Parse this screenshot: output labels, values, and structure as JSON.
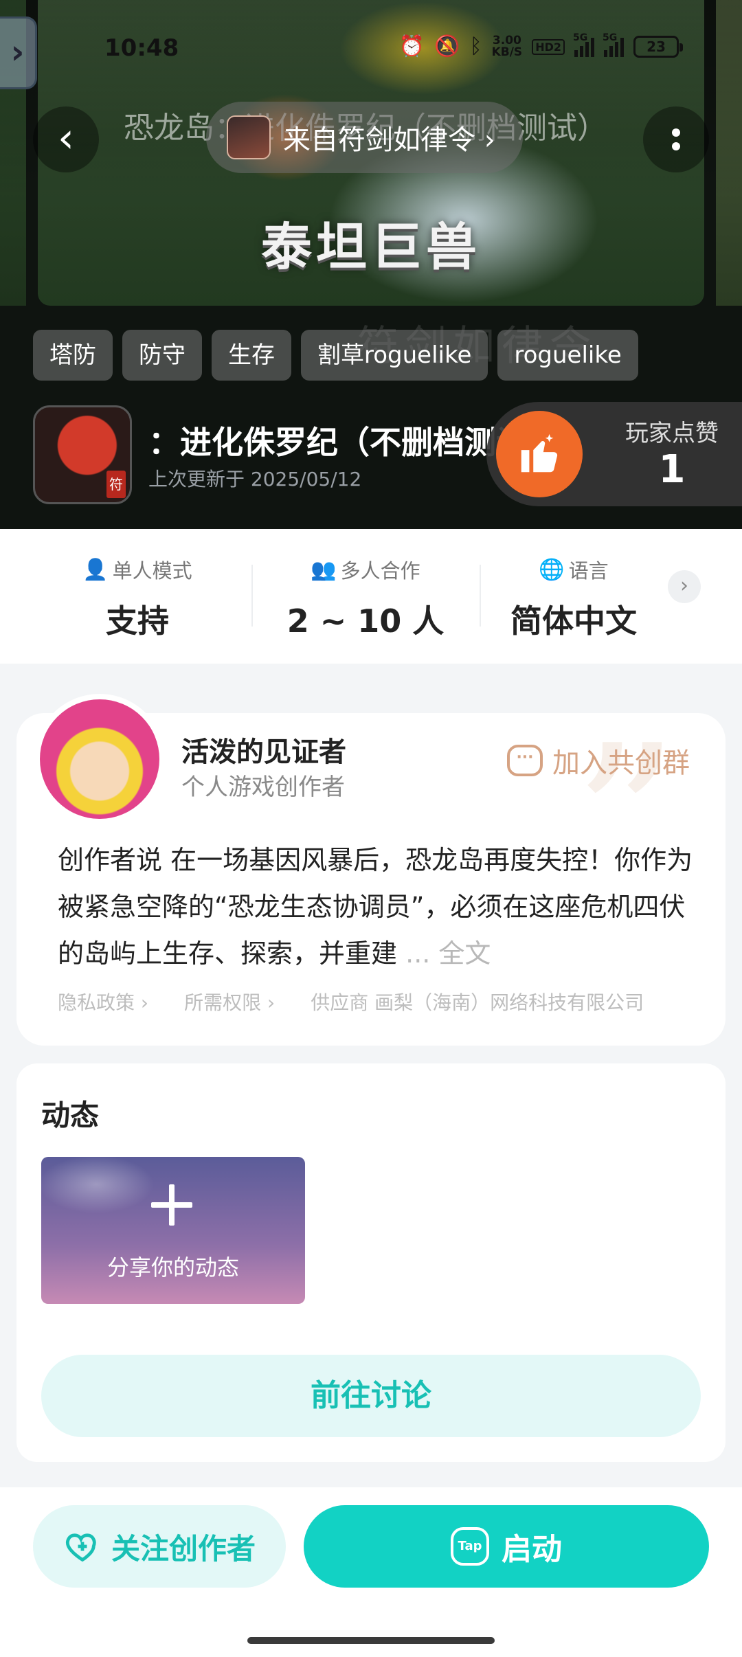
{
  "status_bar": {
    "time": "10:48",
    "net_speed_value": "3.00",
    "net_speed_unit": "KB/S",
    "hd_label": "HD2",
    "sig1_label": "5G",
    "sig2_label": "5G",
    "battery": "23"
  },
  "hero": {
    "banner_title": "泰坦巨兽",
    "ghost_title": "恐龙岛：进化侏罗纪（不删档测试）",
    "source_label": "来自符剑如律令 ›",
    "watermark": "符剑如律令",
    "tags": [
      "塔防",
      "防守",
      "生存",
      "割草roguelike",
      "roguelike"
    ],
    "game_title": "：进化侏罗纪（不删档测试）",
    "icon_badge": "符",
    "updated": "上次更新于 2025/05/12",
    "like_label": "玩家点赞",
    "like_count": "1"
  },
  "info": {
    "single_label": "单人模式",
    "single_value": "支持",
    "multi_label": "多人合作",
    "multi_value": "2 ~ 10 人",
    "lang_label": "语言",
    "lang_value": "简体中文"
  },
  "creator": {
    "name": "活泼的见证者",
    "role": "个人游戏创作者",
    "join_label": "加入共创群",
    "desc_prefix": "创作者说 ",
    "desc": "在一场基因风暴后，恐龙岛再度失控！你作为被紧急空降的“恐龙生态协调员”，必须在这座危机四伏的岛屿上生存、探索，并重建",
    "desc_more": "... 全文",
    "link_privacy": "隐私政策 ›",
    "link_permissions": "所需权限 ›",
    "link_supplier": "供应商 画梨（海南）网络科技有限公司"
  },
  "feed": {
    "title": "动态",
    "share_label": "分享你的动态",
    "discuss_label": "前往讨论"
  },
  "bottom": {
    "follow_label": "关注创作者",
    "launch_label": "启动",
    "tap_icon_text": "Tap"
  },
  "colors": {
    "accent_teal": "#12d2c4",
    "like_orange": "#f06a28",
    "join_tan": "#d6a383"
  },
  "icons": {
    "back": "chevron-left-icon",
    "more": "more-vertical-icon",
    "like": "thumbs-up-icon",
    "single": "user-icon",
    "multi": "users-icon",
    "lang": "globe-icon",
    "join": "chat-plus-icon",
    "follow": "heart-plus-icon",
    "launch": "tap-logo-icon"
  }
}
